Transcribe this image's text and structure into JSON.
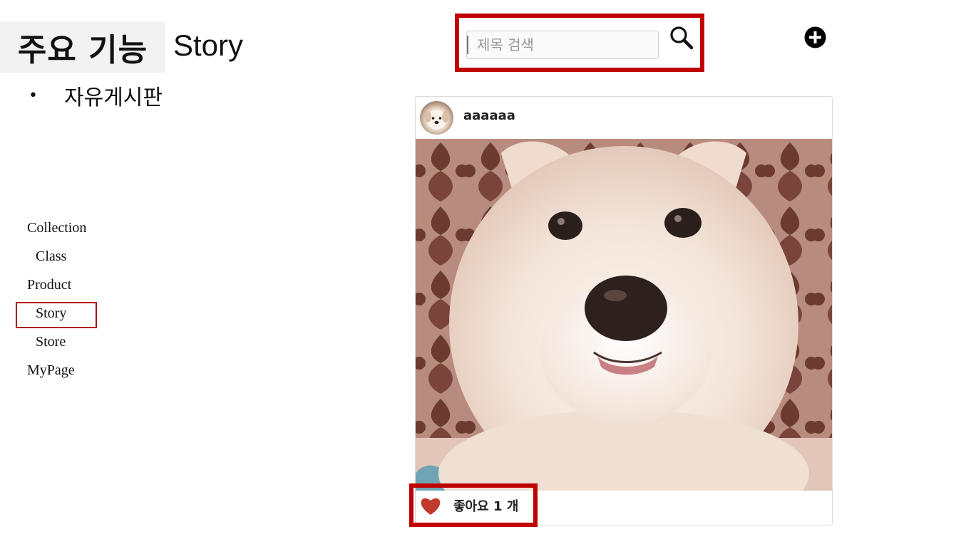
{
  "slide": {
    "title": "주요 기능",
    "subtitle": "Story",
    "bullet": "자유게시판"
  },
  "nav": {
    "items": [
      {
        "label": "Collection"
      },
      {
        "label": "Class"
      },
      {
        "label": "Product"
      },
      {
        "label": "Story"
      },
      {
        "label": "Store"
      },
      {
        "label": "MyPage"
      }
    ],
    "active": "Story"
  },
  "search": {
    "placeholder": "제목 검색",
    "button_icon": "search-icon"
  },
  "add_button": {
    "icon": "plus-circle-icon"
  },
  "post": {
    "username": "aaaaaa",
    "avatar_icon": "avatar",
    "like_icon": "heart-icon",
    "like_text": "좋아요 1 개"
  },
  "colors": {
    "highlight": "#c00000",
    "heart": "#c0392b"
  }
}
